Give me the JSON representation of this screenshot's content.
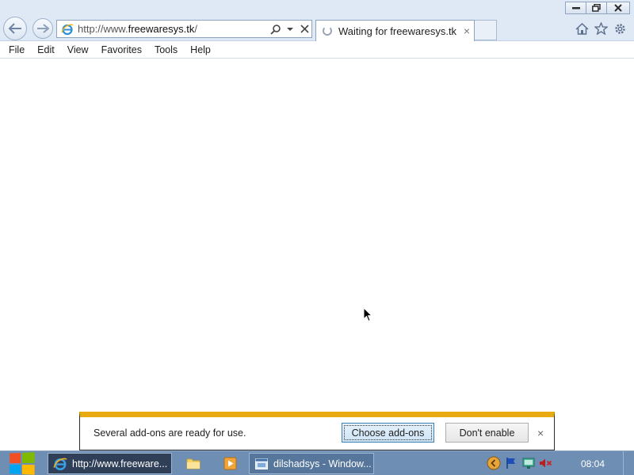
{
  "browser": {
    "address": {
      "url_prefix": "http://www.",
      "url_domain": "freewaresys.tk",
      "url_suffix": "/",
      "search_icon": "search-icon",
      "dropdown_icon": "chevron-down-icon",
      "stop_icon": "close-icon"
    },
    "tab": {
      "title": "Waiting for freewaresys.tk",
      "close": "×"
    },
    "menu": [
      "File",
      "Edit",
      "View",
      "Favorites",
      "Tools",
      "Help"
    ]
  },
  "notification": {
    "message": "Several add-ons are ready for use.",
    "choose_label": "Choose add-ons",
    "dont_enable_label": "Don't enable",
    "close": "×"
  },
  "taskbar": {
    "ie_label": "http://www.freeware...",
    "window_label": "dilshadsys - Window...",
    "clock": "08:04"
  },
  "colors": {
    "chrome_bg": "#dfe9f5",
    "notify_accent": "#e8ab12",
    "taskbar_bg": "#6e8eb3"
  }
}
